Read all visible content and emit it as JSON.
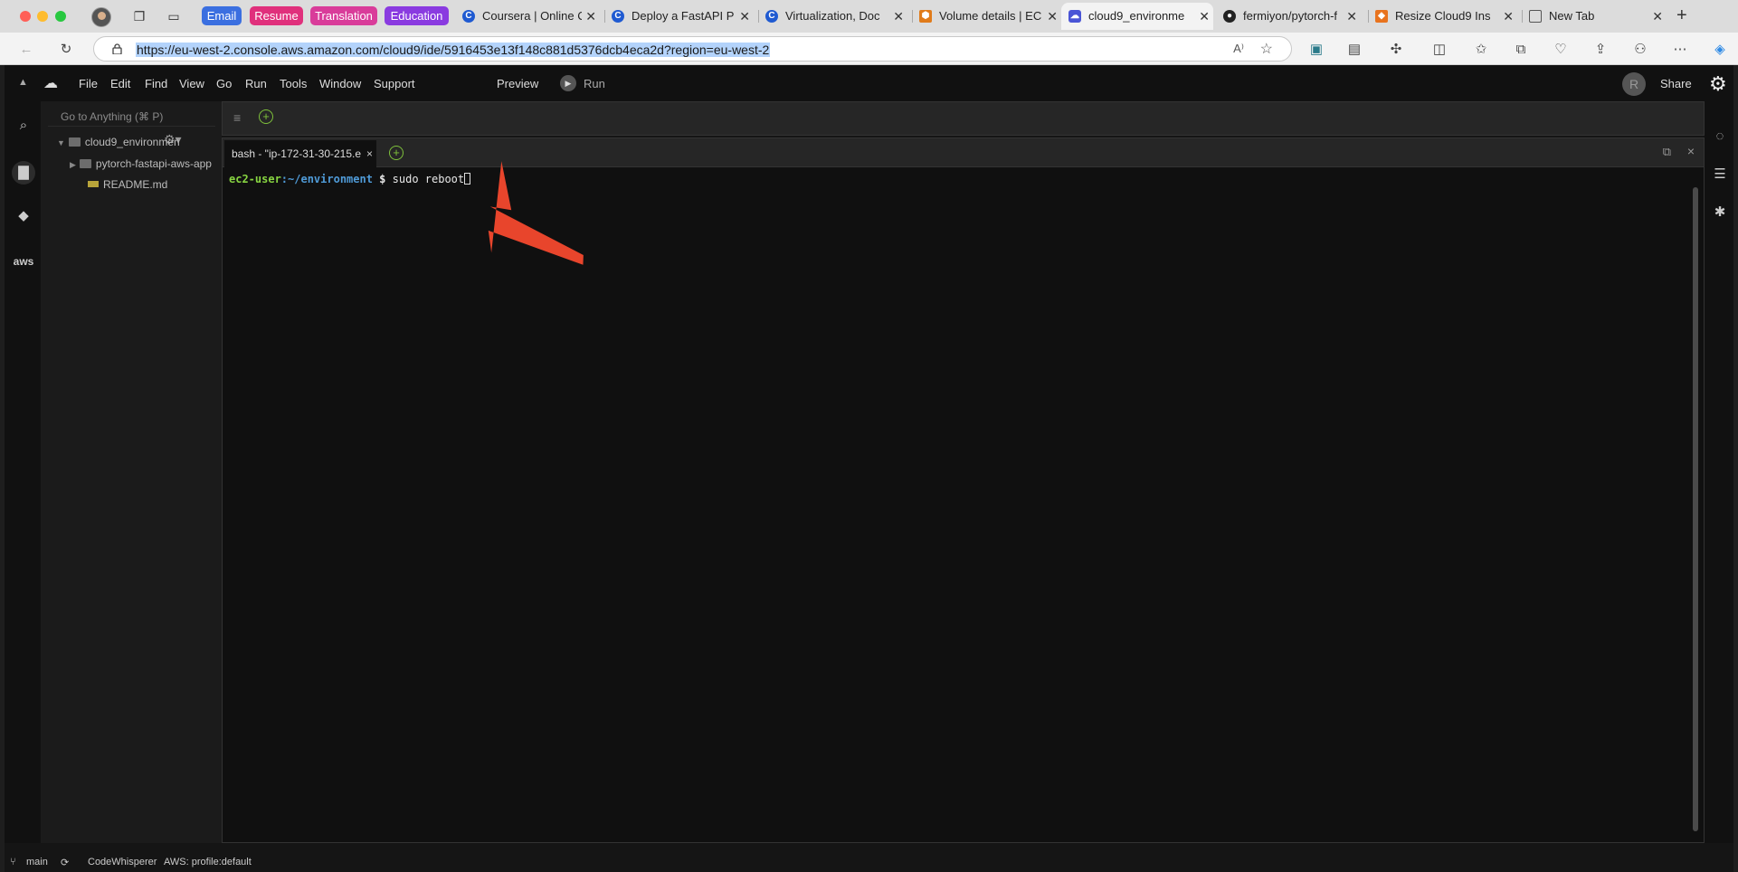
{
  "browser": {
    "tab_groups": [
      {
        "label": "Email",
        "color": "#3b6fe0"
      },
      {
        "label": "Resume",
        "color": "#e0307c"
      },
      {
        "label": "Translation",
        "color": "#d93c9a"
      },
      {
        "label": "Education",
        "color": "#8a3be0"
      }
    ],
    "tabs": [
      {
        "title": "Coursera | Online C",
        "icon": "coursera-icon"
      },
      {
        "title": "Deploy a FastAPI P",
        "icon": "coursera-icon"
      },
      {
        "title": "Virtualization, Doc",
        "icon": "coursera-icon"
      },
      {
        "title": "Volume details | EC",
        "icon": "aws-icon"
      },
      {
        "title": "cloud9_environme",
        "icon": "cloud9-icon",
        "active": true
      },
      {
        "title": "fermiyon/pytorch-f",
        "icon": "github-icon"
      },
      {
        "title": "Resize Cloud9 Ins",
        "icon": "aws-cube-icon"
      },
      {
        "title": "New Tab",
        "icon": "newtab-icon"
      }
    ],
    "url": "https://eu-west-2.console.aws.amazon.com/cloud9/ide/5916453e13f148c881d5376dcb4eca2d?region=eu-west-2"
  },
  "ide": {
    "menu": [
      "File",
      "Edit",
      "Find",
      "View",
      "Go",
      "Run",
      "Tools",
      "Window",
      "Support"
    ],
    "preview_label": "Preview",
    "run_label": "Run",
    "share_label": "Share",
    "avatar_letter": "R",
    "goto_placeholder": "Go to Anything (⌘ P)",
    "tree": {
      "root": "cloud9_environmen",
      "folder": "pytorch-fastapi-aws-app",
      "file": "README.md"
    },
    "terminal": {
      "tab_title": "bash - \"ip-172-31-30-215.e",
      "prompt_user": "ec2-user",
      "prompt_path": ":~/environment",
      "prompt_symbol": " $ ",
      "command": "sudo reboot"
    },
    "status": {
      "branch": "main",
      "codewhisperer": "CodeWhisperer",
      "aws_profile": "AWS: profile:default"
    }
  },
  "colors": {
    "prompt_green": "#87d441",
    "prompt_blue": "#4f9bd8",
    "arrow": "#e8452c"
  }
}
